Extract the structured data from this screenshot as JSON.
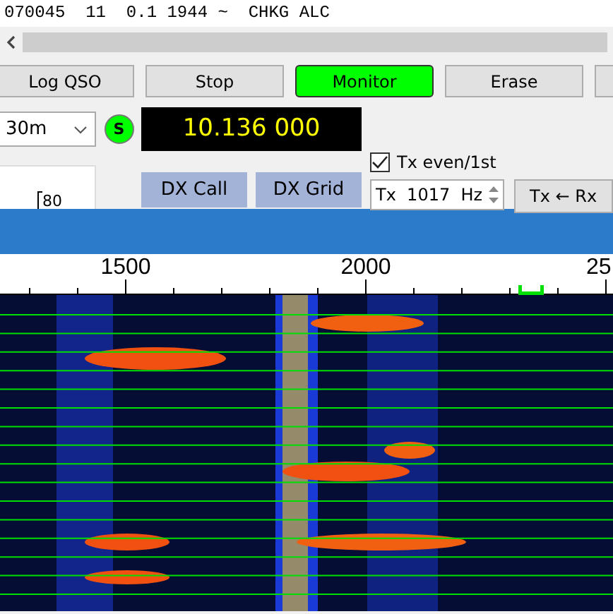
{
  "decode_line": "070045  11  0.1 1944 ~  CHKG ALC",
  "buttons": [
    {
      "label": "Log QSO",
      "on": false
    },
    {
      "label": "Stop",
      "on": false
    },
    {
      "label": "Monitor",
      "on": true
    },
    {
      "label": "Erase",
      "on": false
    },
    {
      "on": false
    }
  ],
  "band": {
    "value": "30m"
  },
  "status_indicator": {
    "label": "S",
    "on": true
  },
  "frequency": "10.136 000",
  "dx_buttons": [
    "DX Call",
    "DX Grid"
  ],
  "meter_scale_label": "80",
  "tx_even": {
    "label": "Tx even/1st",
    "checked": true
  },
  "tx_freq": {
    "prefix": "Tx",
    "value": "1017",
    "unit": "Hz"
  },
  "tx_from_rx_button": "Tx ← Rx",
  "waterfall": {
    "axis_labels": [
      "1500",
      "2000",
      "25"
    ],
    "kind": "picture"
  }
}
